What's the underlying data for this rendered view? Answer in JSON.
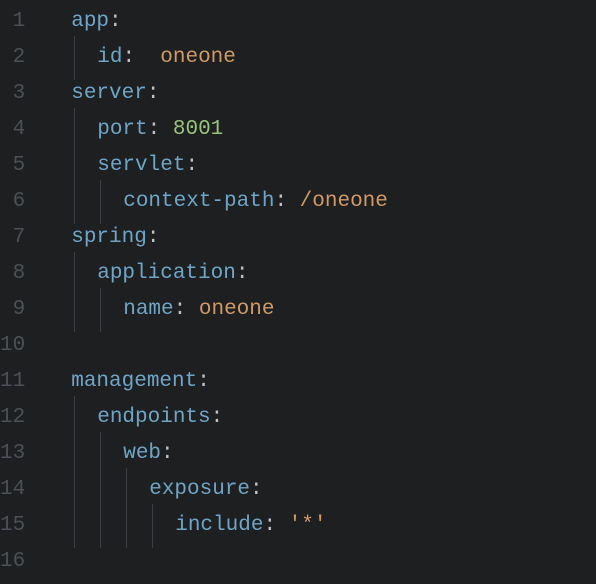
{
  "lines": [
    {
      "n": "1",
      "indent": 0,
      "segs": [
        {
          "t": "app",
          "c": "key"
        },
        {
          "t": ":",
          "c": "colon"
        }
      ]
    },
    {
      "n": "2",
      "indent": 1,
      "segs": [
        {
          "t": "id",
          "c": "key"
        },
        {
          "t": ":",
          "c": "colon"
        },
        {
          "t": "  ",
          "c": "sp"
        },
        {
          "t": "oneone",
          "c": "str"
        }
      ]
    },
    {
      "n": "3",
      "indent": 0,
      "segs": [
        {
          "t": "server",
          "c": "key"
        },
        {
          "t": ":",
          "c": "colon"
        }
      ]
    },
    {
      "n": "4",
      "indent": 1,
      "segs": [
        {
          "t": "port",
          "c": "key"
        },
        {
          "t": ":",
          "c": "colon"
        },
        {
          "t": " ",
          "c": "sp"
        },
        {
          "t": "8001",
          "c": "num"
        }
      ]
    },
    {
      "n": "5",
      "indent": 1,
      "segs": [
        {
          "t": "servlet",
          "c": "key"
        },
        {
          "t": ":",
          "c": "colon"
        }
      ]
    },
    {
      "n": "6",
      "indent": 2,
      "segs": [
        {
          "t": "context-path",
          "c": "key"
        },
        {
          "t": ":",
          "c": "colon"
        },
        {
          "t": " ",
          "c": "sp"
        },
        {
          "t": "/oneone",
          "c": "str"
        }
      ]
    },
    {
      "n": "7",
      "indent": 0,
      "segs": [
        {
          "t": "spring",
          "c": "key"
        },
        {
          "t": ":",
          "c": "colon"
        }
      ]
    },
    {
      "n": "8",
      "indent": 1,
      "segs": [
        {
          "t": "application",
          "c": "key"
        },
        {
          "t": ":",
          "c": "colon"
        }
      ]
    },
    {
      "n": "9",
      "indent": 2,
      "segs": [
        {
          "t": "name",
          "c": "key"
        },
        {
          "t": ":",
          "c": "colon"
        },
        {
          "t": " ",
          "c": "sp"
        },
        {
          "t": "oneone",
          "c": "str"
        }
      ]
    },
    {
      "n": "10",
      "indent": 0,
      "segs": []
    },
    {
      "n": "11",
      "indent": 0,
      "segs": [
        {
          "t": "management",
          "c": "key"
        },
        {
          "t": ":",
          "c": "colon"
        }
      ]
    },
    {
      "n": "12",
      "indent": 1,
      "segs": [
        {
          "t": "endpoints",
          "c": "key"
        },
        {
          "t": ":",
          "c": "colon"
        }
      ]
    },
    {
      "n": "13",
      "indent": 2,
      "segs": [
        {
          "t": "web",
          "c": "key"
        },
        {
          "t": ":",
          "c": "colon"
        }
      ]
    },
    {
      "n": "14",
      "indent": 3,
      "segs": [
        {
          "t": "exposure",
          "c": "key"
        },
        {
          "t": ":",
          "c": "colon"
        }
      ]
    },
    {
      "n": "15",
      "indent": 4,
      "segs": [
        {
          "t": "include",
          "c": "key"
        },
        {
          "t": ":",
          "c": "colon"
        },
        {
          "t": " ",
          "c": "sp"
        },
        {
          "t": "'*'",
          "c": "str"
        }
      ]
    },
    {
      "n": "16",
      "indent": 0,
      "segs": []
    }
  ],
  "base_indent": 1
}
